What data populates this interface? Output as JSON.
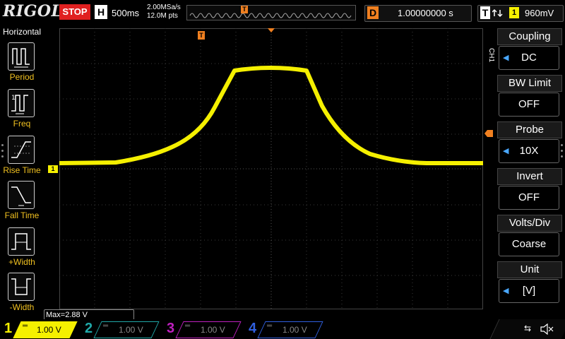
{
  "colors": {
    "ch1": "#f5f000",
    "ch2": "#20a8a8",
    "ch3": "#c020c0",
    "ch4": "#3060e0",
    "grid": "#3a3a3a",
    "stop": "#e02020",
    "trigger": "#f08020",
    "accent": "#4aa8ff"
  },
  "header": {
    "brand": "RIGOL",
    "run_state": "STOP",
    "horiz_letter": "H",
    "timebase": "500ms",
    "sample_rate": "2.00MSa/s",
    "memory_depth": "12.0M pts",
    "trigger_pos_marker": "T",
    "delay_letter": "D",
    "delay": "1.00000000 s",
    "trigger_letter": "T",
    "trigger_edge_icon": "edge-icons",
    "trigger_level": "960mV"
  },
  "left_menu": {
    "title": "Horizontal",
    "items": [
      {
        "label": "Period",
        "icon": "period-icon"
      },
      {
        "label": "Freq",
        "icon": "frequency-icon"
      },
      {
        "label": "Rise Time",
        "icon": "rise-time-icon"
      },
      {
        "label": "Fall Time",
        "icon": "fall-time-icon"
      },
      {
        "label": "+Width",
        "icon": "positive-width-icon"
      },
      {
        "label": "-Width",
        "icon": "negative-width-icon"
      }
    ]
  },
  "right_menu": {
    "channel_tag": "CH1",
    "items": [
      {
        "title": "Coupling",
        "value": "DC",
        "has_arrow": true
      },
      {
        "title": "BW Limit",
        "value": "OFF",
        "has_arrow": false
      },
      {
        "title": "Probe",
        "value": "10X",
        "has_arrow": true
      },
      {
        "title": "Invert",
        "value": "OFF",
        "has_arrow": false
      },
      {
        "title": "Volts/Div",
        "value": "Coarse",
        "has_arrow": false
      },
      {
        "title": "Unit",
        "value": "[V]",
        "has_arrow": true
      }
    ]
  },
  "measurement": {
    "max_label": "Max=2.88 V"
  },
  "markers": {
    "ch1_ground": "1",
    "trigger_top": "T"
  },
  "channels": [
    {
      "num": "1",
      "scale": "1.00 V",
      "active": true
    },
    {
      "num": "2",
      "scale": "1.00 V",
      "active": false
    },
    {
      "num": "3",
      "scale": "1.00 V",
      "active": false
    },
    {
      "num": "4",
      "scale": "1.00 V",
      "active": false
    }
  ],
  "status_icons": [
    "usb-icon",
    "speaker-mute-icon"
  ]
}
